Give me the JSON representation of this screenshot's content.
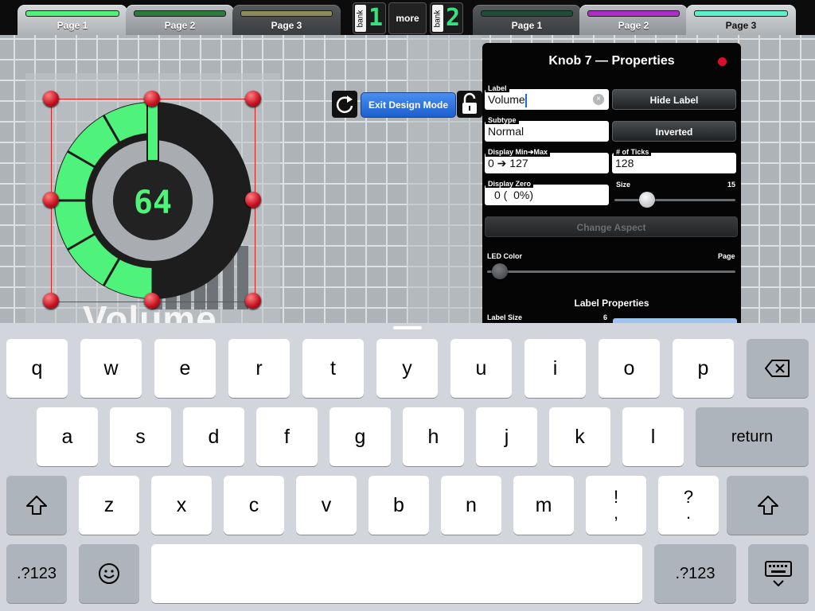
{
  "topbar": {
    "left_tabs": [
      {
        "label": "Page 1",
        "color": "#4ff27a"
      },
      {
        "label": "Page 2",
        "color": "#2e7a3a"
      },
      {
        "label": "Page 3",
        "color": "#8c8c5a"
      }
    ],
    "bank_left": {
      "text": "bank",
      "number": "1"
    },
    "more_label": "more",
    "bank_right": {
      "text": "bank",
      "number": "2"
    },
    "right_tabs": [
      {
        "label": "Page 1",
        "color": "#1f4d38"
      },
      {
        "label": "Page 2",
        "color": "#b02ec8"
      },
      {
        "label": "Page 3",
        "color": "#5cf0c8"
      }
    ]
  },
  "knob": {
    "value_display": "64",
    "level": 0.5,
    "label": "Volume",
    "accent": "#4ff27a"
  },
  "design_toolbar": {
    "exit_label": "Exit Design Mode",
    "refresh_icon": "refresh-icon",
    "lock_icon": "lock-open-icon"
  },
  "properties": {
    "title": "Knob 7 — Properties",
    "label_field": {
      "label": "Label",
      "value": "Volume"
    },
    "hide_label_button": "Hide Label",
    "subtype_field": {
      "label": "Subtype",
      "value": "Normal"
    },
    "inverted_button": "Inverted",
    "display_range": {
      "label": "Display Min➔Max",
      "value": "0 ➔ 127"
    },
    "ticks_field": {
      "label": "# of Ticks",
      "value": "128"
    },
    "display_zero": {
      "label": "Display Zero",
      "value": "0 (  0%)"
    },
    "size": {
      "label": "Size",
      "value": "15",
      "fraction": 0.27
    },
    "change_aspect_button": "Change Aspect",
    "led_color": {
      "label": "LED Color",
      "right_label": "Page",
      "fraction": 0.05
    },
    "label_properties_heading": "Label Properties",
    "label_size": {
      "label": "Label Size",
      "value": "6"
    }
  },
  "keyboard": {
    "row1": [
      "q",
      "w",
      "e",
      "r",
      "t",
      "y",
      "u",
      "i",
      "o",
      "p"
    ],
    "row2": [
      "a",
      "s",
      "d",
      "f",
      "g",
      "h",
      "j",
      "k",
      "l"
    ],
    "row3": [
      "z",
      "x",
      "c",
      "v",
      "b",
      "n",
      "m"
    ],
    "punct1": {
      "top": "!",
      "bottom": ","
    },
    "punct2": {
      "top": "?",
      "bottom": "."
    },
    "return_label": "return",
    "numbers_label": ".?123",
    "delete_icon": "backspace-icon",
    "shift_icon": "shift-icon",
    "emoji_icon": "emoji-icon",
    "dismiss_icon": "keyboard-dismiss-icon"
  }
}
